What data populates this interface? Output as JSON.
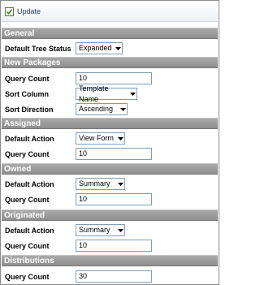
{
  "toolbar": {
    "update_label": "Update"
  },
  "sections": {
    "general": {
      "title": "General",
      "default_tree_status": {
        "label": "Default Tree Status",
        "value": "Expanded"
      }
    },
    "new_packages": {
      "title": "New Packages",
      "query_count": {
        "label": "Query Count",
        "value": "10"
      },
      "sort_column": {
        "label": "Sort Column",
        "value": "Template Name"
      },
      "sort_direction": {
        "label": "Sort Direction",
        "value": "Ascending"
      }
    },
    "assigned": {
      "title": "Assigned",
      "default_action": {
        "label": "Default Action",
        "value": "View Form"
      },
      "query_count": {
        "label": "Query Count",
        "value": "10"
      }
    },
    "owned": {
      "title": "Owned",
      "default_action": {
        "label": "Default Action",
        "value": "Summary"
      },
      "query_count": {
        "label": "Query Count",
        "value": "10"
      }
    },
    "originated": {
      "title": "Originated",
      "default_action": {
        "label": "Default Action",
        "value": "Summary"
      },
      "query_count": {
        "label": "Query Count",
        "value": "10"
      }
    },
    "distributions": {
      "title": "Distributions",
      "query_count": {
        "label": "Query Count",
        "value": "30"
      }
    }
  },
  "colors": {
    "section_header_bg": "#9b9b9b",
    "input_border": "#7f9db9",
    "link_blue": "#1c3f88"
  }
}
